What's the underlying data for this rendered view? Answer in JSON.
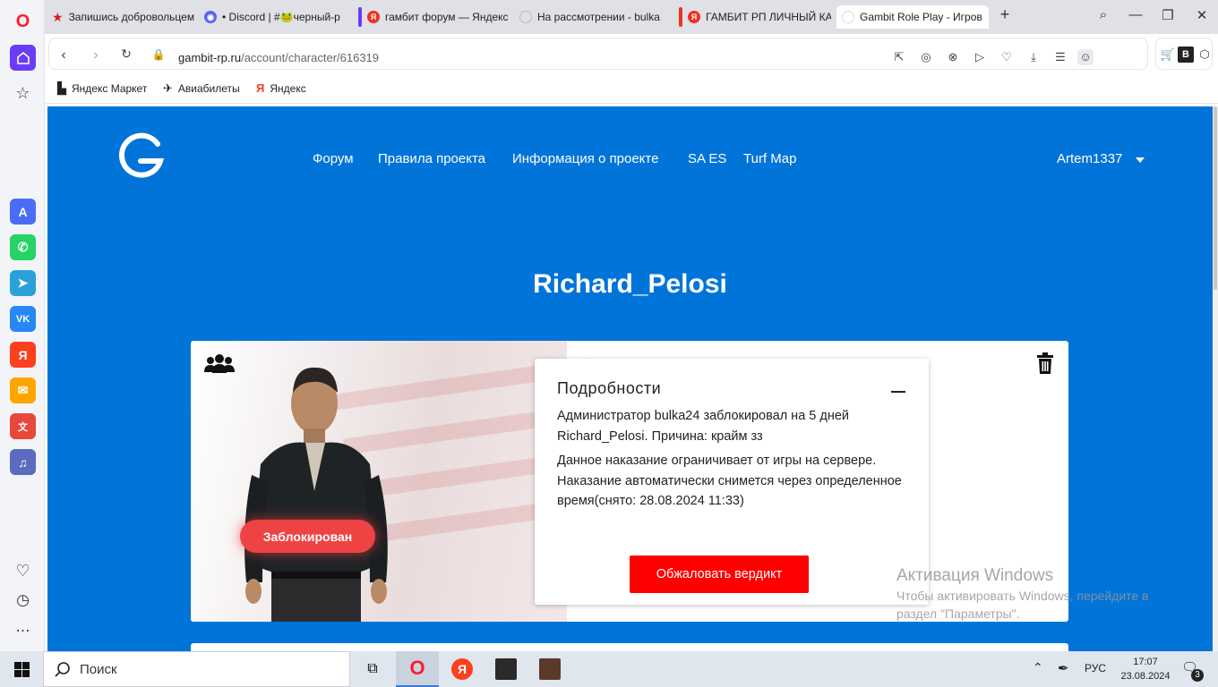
{
  "browser": {
    "tabs": [
      {
        "title": "Запишись добровольцем",
        "favicon": "star-icon",
        "color": "#d81e1e"
      },
      {
        "title": "• Discord | #🐸черный-р",
        "favicon": "discord-icon",
        "color": "#5865f2"
      },
      {
        "title": "гамбит форум — Яндекс",
        "favicon": "yandex-icon",
        "color": "#ef3124"
      },
      {
        "title": "На рассмотрении - bulka",
        "favicon": "loading-icon",
        "color": "#bbbbbb"
      },
      {
        "title": "ГАМБИТ РП ЛИЧНЫЙ КА",
        "favicon": "yandex-icon",
        "color": "#ef3124"
      },
      {
        "title": "Gambit Role Play - Игров",
        "favicon": "page-icon",
        "color": "#ffffff"
      }
    ],
    "address": {
      "host": "gambit-rp.ru",
      "path": "/account/character/616319"
    },
    "bookmarks": [
      {
        "label": "Яндекс Маркет",
        "icon": "market-icon"
      },
      {
        "label": "Авиабилеты",
        "icon": "plane-icon"
      },
      {
        "label": "Яндекс",
        "icon": "yandex-icon"
      }
    ]
  },
  "site": {
    "nav": [
      "Форум",
      "Правила проекта",
      "Информация о проекте",
      "SA ES",
      "Turf Map"
    ],
    "user": "Artem1337",
    "character_name": "Richard_Pelosi",
    "status_badge": "Заблокирован",
    "details": {
      "title": "Подробности",
      "line1": "Администратор bulka24 заблокировал на 5 дней Richard_Pelosi. Причина: крайм зз",
      "line2": "Данное наказание ограничивает от игры на сервере. Наказание автоматически снимется через определенное время(снято: 28.08.2024 11:33)",
      "appeal_button": "Обжаловать вердикт"
    }
  },
  "watermark": {
    "title": "Активация Windows",
    "text": "Чтобы активировать Windows, перейдите в раздел \"Параметры\"."
  },
  "taskbar": {
    "search_label": "Поиск",
    "lang": "РУС",
    "time": "17:07",
    "date": "23.08.2024",
    "notifications": "3"
  },
  "colors": {
    "page_bg": "#0074d9",
    "ban_badge": "#ef4343",
    "appeal": "#ff0000"
  }
}
